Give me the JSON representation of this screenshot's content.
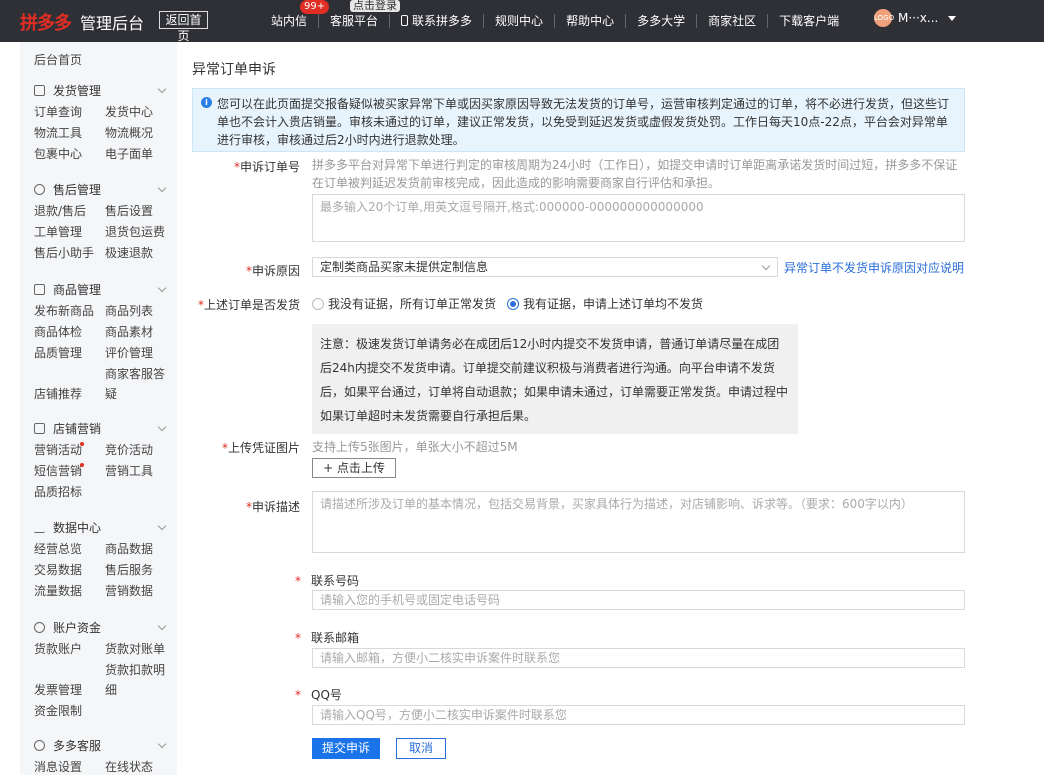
{
  "header": {
    "logo": "拼多多",
    "logo_sub": "管理后台",
    "back_home": "返回首页",
    "tooltip": "点击登录",
    "nav": [
      {
        "label": "站内信",
        "badge": "99+"
      },
      {
        "label": "客服平台"
      },
      {
        "label": "联系拼多多",
        "icon": "phone-icon"
      },
      {
        "label": "规则中心"
      },
      {
        "label": "帮助中心"
      },
      {
        "label": "多多大学"
      },
      {
        "label": "商家社区"
      },
      {
        "label": "下载客户端"
      }
    ],
    "user": {
      "avatar_text": "LOGO",
      "name": "M···x..."
    }
  },
  "sidebar": {
    "home": "后台首页",
    "sections": [
      {
        "title": "发货管理",
        "icon": "document-icon",
        "links": [
          "订单查询",
          "发货中心",
          "物流工具",
          "物流概况",
          "包裹中心",
          "电子面单"
        ]
      },
      {
        "title": "售后管理",
        "icon": "shield-icon",
        "links": [
          "退款/售后",
          "售后设置",
          "工单管理",
          "退货包运费",
          "售后小助手",
          "极速退款"
        ]
      },
      {
        "title": "商品管理",
        "icon": "box-icon",
        "links": [
          "发布新商品",
          "商品列表",
          "商品体检",
          "商品素材",
          "品质管理",
          "评价管理",
          "店铺推荐",
          "商家客服答疑"
        ]
      },
      {
        "title": "店铺营销",
        "icon": "gift-icon",
        "links": [
          "营销活动",
          "竞价活动",
          "短信营销",
          "营销工具",
          "品质招标"
        ]
      },
      {
        "title": "数据中心",
        "icon": "bar-chart-icon",
        "links": [
          "经营总览",
          "商品数据",
          "交易数据",
          "售后服务",
          "流量数据",
          "营销数据"
        ]
      },
      {
        "title": "账户资金",
        "icon": "yen-icon",
        "links": [
          "货款账户",
          "货款对账单",
          "发票管理",
          "货款扣款明细",
          "资金限制"
        ]
      },
      {
        "title": "多多客服",
        "icon": "headset-icon",
        "links": [
          "消息设置",
          "在线状态"
        ]
      }
    ]
  },
  "main": {
    "title": "异常订单申诉",
    "notice": "您可以在此页面提交报备疑似被买家异常下单或因买家原因导致无法发货的订单号，运营审核判定通过的订单，将不必进行发货，但这些订单也不会计入贵店销量。审核未通过的订单，建议正常发货，以免受到延迟发货或虚假发货处罚。工作日每天10点-22点，平台会对异常单进行审核，审核通过后2小时内进行退款处理。",
    "order_label": "申诉订单号",
    "order_hint": "拼多多平台对异常下单进行判定的审核周期为24小时（工作日），如提交申请时订单距离承诺发货时间过短，拼多多不保证在订单被判延迟发货前审核完成，因此造成的影响需要商家自行评估和承担。",
    "order_placeholder": "最多输入20个订单,用英文逗号隔开,格式:000000-000000000000000",
    "reason_label": "申诉原因",
    "reason_value": "定制类商品买家未提供定制信息",
    "reason_link": "异常订单不发货申诉原因对应说明",
    "ship_label": "上述订单是否发货",
    "ship_option1": "我没有证据，所有订单正常发货",
    "ship_option2": "我有证据，申请上述订单均不发货",
    "note": "注意：极速发货订单请务必在成团后12小时内提交不发货申请，普通订单请尽量在成团后24h内提交不发货申请。订单提交前建议积极与消费者进行沟通。向平台申请不发货后，如果平台通过，订单将自动退款；如果申请未通过，订单需要正常发货。申请过程中如果订单超时未发货需要自行承担后果。",
    "upload_label": "上传凭证图片",
    "upload_hint": "支持上传5张图片，单张大小不超过5M",
    "upload_button": "+ 点击上传",
    "desc_label": "申诉描述",
    "desc_placeholder": "请描述所涉及订单的基本情况，包括交易背景，买家具体行为描述，对店铺影响、诉求等。（要求：600字以内）",
    "phone_label": "联系号码",
    "phone_placeholder": "请输入您的手机号或固定电话号码",
    "email_label": "联系邮箱",
    "email_placeholder": "请输入邮箱，方便小二核实申诉案件时联系您",
    "qq_label": "QQ号",
    "qq_placeholder": "请输入QQ号，方便小二核实申诉案件时联系您",
    "submit": "提交申诉",
    "cancel": "取消"
  },
  "colors": {
    "brand": "#e02e24",
    "primary": "#1a73e8",
    "topbar": "#2f3036"
  }
}
